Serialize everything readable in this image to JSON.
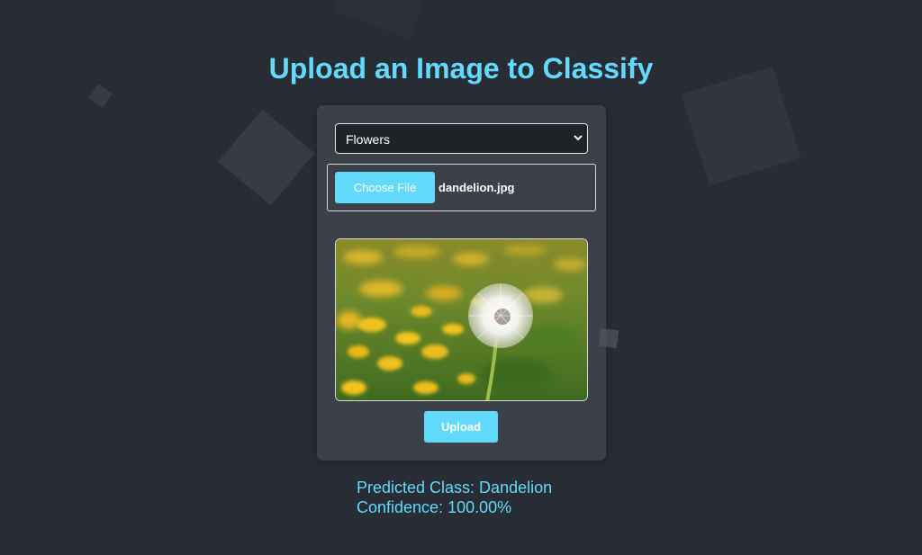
{
  "header": {
    "title": "Upload an Image to Classify"
  },
  "form": {
    "category_select": {
      "selected": "Flowers"
    },
    "file_input": {
      "button_label": "Choose File",
      "file_name": "dandelion.jpg"
    },
    "preview_image": {
      "subject": "dandelion seed head in a field of yellow flowers"
    },
    "upload_label": "Upload"
  },
  "result": {
    "predicted_class": "Predicted Class: Dandelion",
    "confidence": "Confidence: 100.00%"
  },
  "colors": {
    "background": "#282c34",
    "card": "#3c4048",
    "accent": "#61dafb"
  }
}
